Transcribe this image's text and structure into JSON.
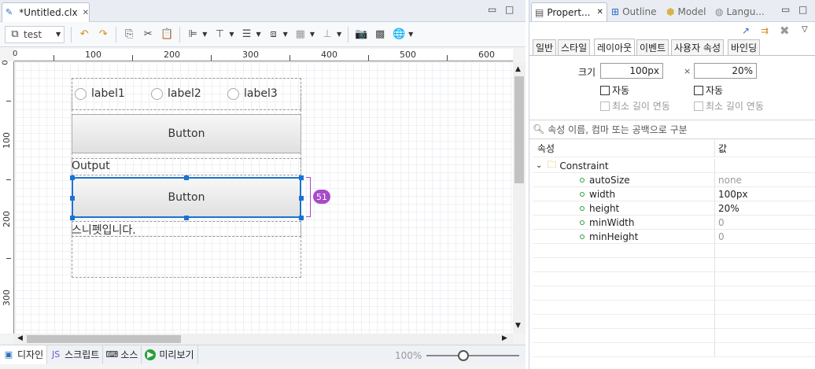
{
  "editor": {
    "file_tab": "*Untitled.clx",
    "toolbar": {
      "test_label": "test"
    },
    "ruler_top": [
      "0",
      "100",
      "200",
      "300",
      "400",
      "500",
      "600"
    ],
    "ruler_left": [
      "0",
      "100",
      "200",
      "300"
    ],
    "radios": [
      "label1",
      "label2",
      "label3"
    ],
    "button1": "Button",
    "output_label": "Output",
    "button2": "Button",
    "badge": "51",
    "snippet_text": "스니펫입니다.",
    "bottom_tabs": [
      "디자인",
      "스크립트",
      "소스",
      "미리보기"
    ],
    "zoom": "100%",
    "zoom_slider_level": 0.4
  },
  "props": {
    "tabs": [
      "Propert...",
      "Outline",
      "Model",
      "Langu..."
    ],
    "subtabs": [
      "일반",
      "스타일",
      "레이아웃",
      "이벤트",
      "사용자 속성",
      "바인딩"
    ],
    "active_subtab": "레이아웃",
    "size_label": "크기",
    "width_value": "100px",
    "times": "×",
    "height_value": "20%",
    "auto_label": "자동",
    "minlen_label": "최소 길이 연동",
    "search_placeholder": "속성 이름, 컴마 또는 공백으로 구분",
    "col_prop": "속성",
    "col_value": "값",
    "group": "Constraint",
    "rows": [
      {
        "k": "autoSize",
        "v": "none"
      },
      {
        "k": "width",
        "v": "100px"
      },
      {
        "k": "height",
        "v": "20%"
      },
      {
        "k": "minWidth",
        "v": "0"
      },
      {
        "k": "minHeight",
        "v": "0"
      }
    ]
  },
  "colors": {
    "accent": "#1a73d1",
    "badge": "#a84ac9"
  }
}
